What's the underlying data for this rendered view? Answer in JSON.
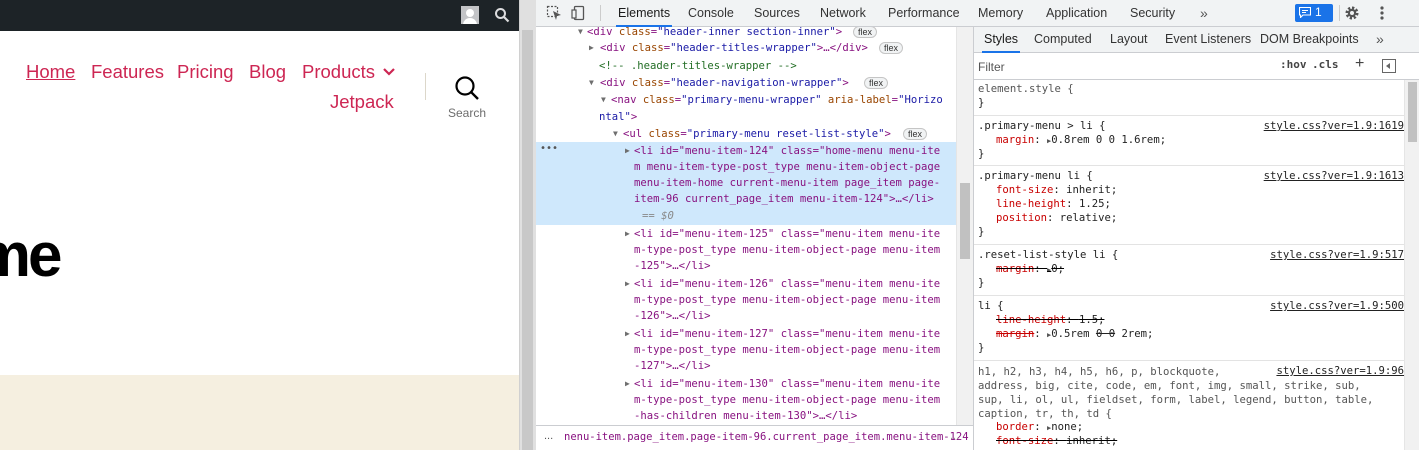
{
  "site": {
    "nav": {
      "home": "Home",
      "features": "Features",
      "pricing": "Pricing",
      "blog": "Blog",
      "products": "Products",
      "jetpack": "Jetpack"
    },
    "search_label": "Search",
    "hero_fragment": "ome"
  },
  "devtools": {
    "tabs": {
      "elements": "Elements",
      "console": "Console",
      "sources": "Sources",
      "network": "Network",
      "performance": "Performance",
      "memory": "Memory",
      "application": "Application",
      "security": "Security",
      "more": "»"
    },
    "issues_count": "1",
    "dom": {
      "l1_tag": "<div ",
      "l1_attr": "class",
      "l1_val": "\"header-inner section-inner\"",
      "l1_end": ">",
      "l1_badge": "flex",
      "l2_tag": "<div ",
      "l2_attr": "class",
      "l2_val": "\"header-titles-wrapper\"",
      "l2_end": ">…</div>",
      "l2_badge": "flex",
      "l3_comment": "<!-- .header-titles-wrapper -->",
      "l4_tag": "<div ",
      "l4_attr": "class",
      "l4_val": "\"header-navigation-wrapper\"",
      "l4_end": ">",
      "l4_badge": "flex",
      "l5_tag": "<nav ",
      "l5_attr": "class",
      "l5_val": "\"primary-menu-wrapper\"",
      "l5_attr2": "aria-label",
      "l5_val2": "\"Horizo",
      "l6_val": "ntal\"",
      "l6_end": ">",
      "l7_tag": "<ul ",
      "l7_attr": "class",
      "l7_val": "\"primary-menu reset-list-style\"",
      "l7_end": ">",
      "l7_badge": "flex",
      "sel_1": "<li id=\"menu-item-124\" class=\"home-menu menu-ite",
      "sel_2": "m menu-item-type-post_type menu-item-object-page",
      "sel_3": "menu-item-home current-menu-item page_item page-",
      "sel_4": "item-96 current_page_item menu-item-124\">…</li>",
      "sel_5": "== $0",
      "sel_dots": "•••",
      "li125_1": "<li id=\"menu-item-125\" class=\"menu-item menu-ite",
      "li125_2": "m-type-post_type menu-item-object-page menu-item",
      "li125_3": "-125\">…</li>",
      "li126_1": "<li id=\"menu-item-126\" class=\"menu-item menu-ite",
      "li126_2": "m-type-post_type menu-item-object-page menu-item",
      "li126_3": "-126\">…</li>",
      "li127_1": "<li id=\"menu-item-127\" class=\"menu-item menu-ite",
      "li127_2": "m-type-post_type menu-item-object-page menu-item",
      "li127_3": "-127\">…</li>",
      "li130_1": "<li id=\"menu-item-130\" class=\"menu-item menu-ite",
      "li130_2": "m-type-post_type menu-item-object-page menu-item",
      "li130_3": "-has-children menu-item-130\">…</li>"
    },
    "breadcrumb": {
      "left": "...",
      "text": "nenu-item.page_item.page-item-96.current_page_item.menu-item-124",
      "right": "..."
    },
    "styles": {
      "tabs": {
        "styles": "Styles",
        "computed": "Computed",
        "layout": "Layout",
        "listeners": "Event Listeners",
        "dom_breakpoints": "DOM Breakpoints",
        "more": "»"
      },
      "filter_placeholder": "Filter",
      "hov": ":hov",
      "cls": ".cls",
      "plus": "+",
      "rules": {
        "r1_sel": "element.style {",
        "r1_close": "}",
        "r2_sel": ".primary-menu > li {",
        "r2_src": "style.css?ver=1.9:1619",
        "r2_p1": "margin",
        "r2_v1": "0.8rem 0 0 1.6rem;",
        "r2_close": "}",
        "r3_sel": ".primary-menu li {",
        "r3_src": "style.css?ver=1.9:1613",
        "r3_p1": "font-size",
        "r3_v1": "inherit;",
        "r3_p2": "line-height",
        "r3_v2": "1.25;",
        "r3_p3": "position",
        "r3_v3": "relative;",
        "r3_close": "}",
        "r4_sel": ".reset-list-style li {",
        "r4_src": "style.css?ver=1.9:517",
        "r4_p1": "margin",
        "r4_v1": "0;",
        "r4_close": "}",
        "r5_sel": "li {",
        "r5_src": "style.css?ver=1.9:500",
        "r5_p1": "line-height",
        "r5_v1": "1.5;",
        "r5_p2": "margin",
        "r5_v2a": "0.5rem",
        "r5_v2b": "0 0",
        "r5_v2c": "2rem;",
        "r5_close": "}",
        "r6_sel": "h1, h2, h3, h4, h5, h6, p, blockquote,\naddress, big, cite, code, em, font, img, small, strike, sub,\nsup, li, ol, ul, fieldset, form, label, legend, button, table,\ncaption, tr, th, td {",
        "r6_src": "style.css?ver=1.9:96",
        "r6_p1": "border",
        "r6_v1": "none;",
        "r6_p2": "font-size",
        "r6_v2": "inherit;"
      }
    }
  },
  "colors": {
    "link": "#cd2653",
    "admin_bar": "#1d2327",
    "accent": "#1a73e8",
    "selected_row": "#cfe8fc"
  }
}
